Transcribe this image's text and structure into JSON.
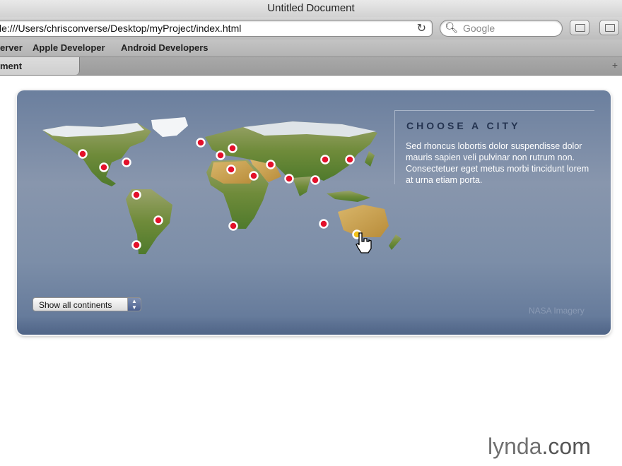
{
  "window": {
    "title": "Untitled Document"
  },
  "toolbar": {
    "url": "le:///Users/chrisconverse/Desktop/myProject/index.html",
    "search_placeholder": "Google"
  },
  "bookmarks": [
    "erver",
    "Apple Developer",
    "Android Developers"
  ],
  "tab": {
    "label": "ment"
  },
  "panel": {
    "heading": "CHOOSE A CITY",
    "description": "Sed rhoncus lobortis dolor suspendisse dolor mauris sapien veli pulvinar non rutrum non. Consectetuer eget metus morbi tincidunt lorem at urna etiam porta.",
    "select_value": "Show all continents",
    "credit": "NASA Imagery"
  },
  "brand": {
    "logo_text": "lynda",
    "logo_suffix": ".com"
  },
  "colors": {
    "marker": "#e3102a",
    "panel_top": "#6b7f9e",
    "heading": "#243350"
  },
  "city_marker_count": 20
}
